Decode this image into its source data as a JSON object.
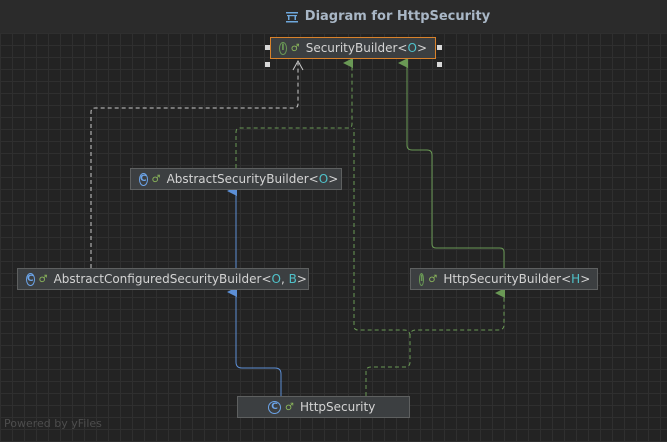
{
  "window": {
    "title": "Diagram for HttpSecurity",
    "title_icon": "uml-diagram-icon"
  },
  "nodes": {
    "security_builder": {
      "name": "SecurityBuilder<",
      "param": "O",
      "close": ">",
      "kind": "interface",
      "kind_glyph": "I"
    },
    "abstract_security_builder": {
      "name": "AbstractSecurityBuilder<",
      "param": "O",
      "close": ">",
      "kind": "abstract-class",
      "kind_glyph": "C"
    },
    "abstract_configured_security_builder": {
      "name": "AbstractConfiguredSecurityBuilder<",
      "param1": "O",
      "sep": ", ",
      "param2": "B",
      "close": ">",
      "kind": "abstract-class",
      "kind_glyph": "C"
    },
    "http_security_builder": {
      "name": "HttpSecurityBuilder<",
      "param": "H",
      "close": ">",
      "kind": "interface",
      "kind_glyph": "I"
    },
    "http_security": {
      "name": "HttpSecurity",
      "kind": "class",
      "kind_glyph": "C"
    }
  },
  "access_glyph": "♂",
  "watermark": "Powered by yFiles",
  "colors": {
    "implements_edge": "#6a9955",
    "extends_edge": "#5c8fd6",
    "dashed_white_edge": "#c8c8c8",
    "selection": "#d9822b",
    "type_param": "#4fc1c9"
  }
}
